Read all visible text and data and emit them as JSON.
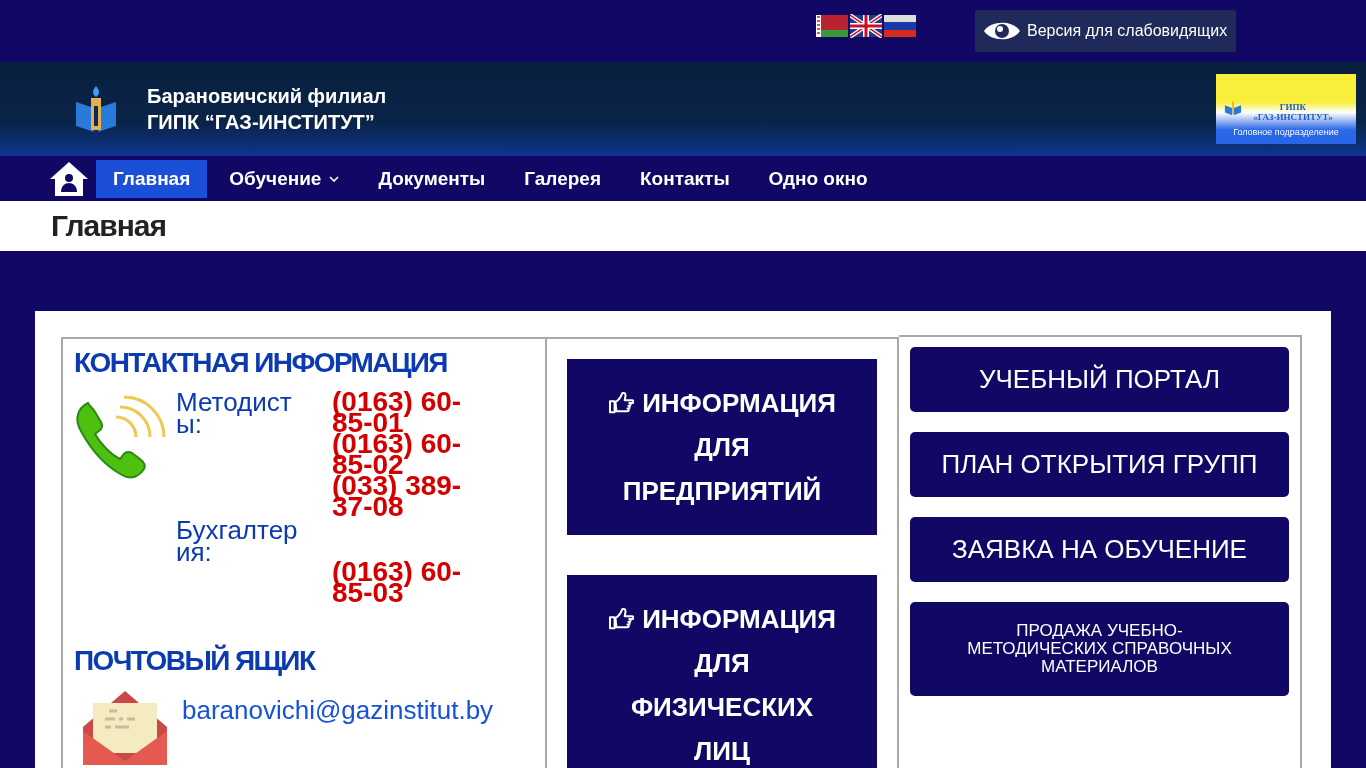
{
  "accessibility_button": {
    "label": "Версия для слабовидящих"
  },
  "header": {
    "title_lines": [
      "Барановичский филиал",
      "ГИПК “ГАЗ-ИНСТИТУТ”"
    ],
    "banner": {
      "lines": [
        "ГИПК",
        "«ГАЗ-ИНСТИТУТ»"
      ],
      "caption": "Головное подразделение"
    }
  },
  "nav": {
    "items": [
      {
        "label": "Главная",
        "selected": true,
        "dropdown": false
      },
      {
        "label": "Обучение",
        "selected": false,
        "dropdown": true
      },
      {
        "label": "Документы",
        "selected": false,
        "dropdown": false
      },
      {
        "label": "Галерея",
        "selected": false,
        "dropdown": false
      },
      {
        "label": "Контакты",
        "selected": false,
        "dropdown": false
      },
      {
        "label": "Одно окно",
        "selected": false,
        "dropdown": false
      }
    ]
  },
  "page_title": "Главная",
  "contacts": {
    "heading": "КОНТАКТНАЯ ИНФОРМАЦИЯ",
    "groups": [
      {
        "label": "Методисты:",
        "phones": [
          "(0163) 60-85-01",
          "(0163) 60-85-02",
          "(033) 389-37-08"
        ]
      },
      {
        "label": "Бухгалтерия:",
        "phones": [
          "(0163) 60-85-03"
        ]
      }
    ],
    "mail_heading": "ПОЧТОВЫЙ ЯЩИК",
    "email": "baranovichi@gazinstitut.by"
  },
  "info_buttons": [
    {
      "lines": [
        "ИНФОРМАЦИЯ",
        "ДЛЯ",
        "ПРЕДПРИЯТИЙ"
      ]
    },
    {
      "lines": [
        "ИНФОРМАЦИЯ",
        "ДЛЯ",
        "ФИЗИЧЕСКИХ",
        "ЛИЦ"
      ]
    }
  ],
  "link_buttons": [
    {
      "label": "УЧЕБНЫЙ ПОРТАЛ",
      "kind": "large"
    },
    {
      "label": "ПЛАН ОТКРЫТИЯ ГРУПП",
      "kind": "large"
    },
    {
      "label": "ЗАЯВКА НА ОБУЧЕНИЕ",
      "kind": "large"
    },
    {
      "label": "ПРОДАЖА УЧЕБНО-МЕТОДИЧЕСКИХ СПРАВОЧНЫХ МАТЕРИАЛОВ",
      "kind": "compact"
    }
  ]
}
